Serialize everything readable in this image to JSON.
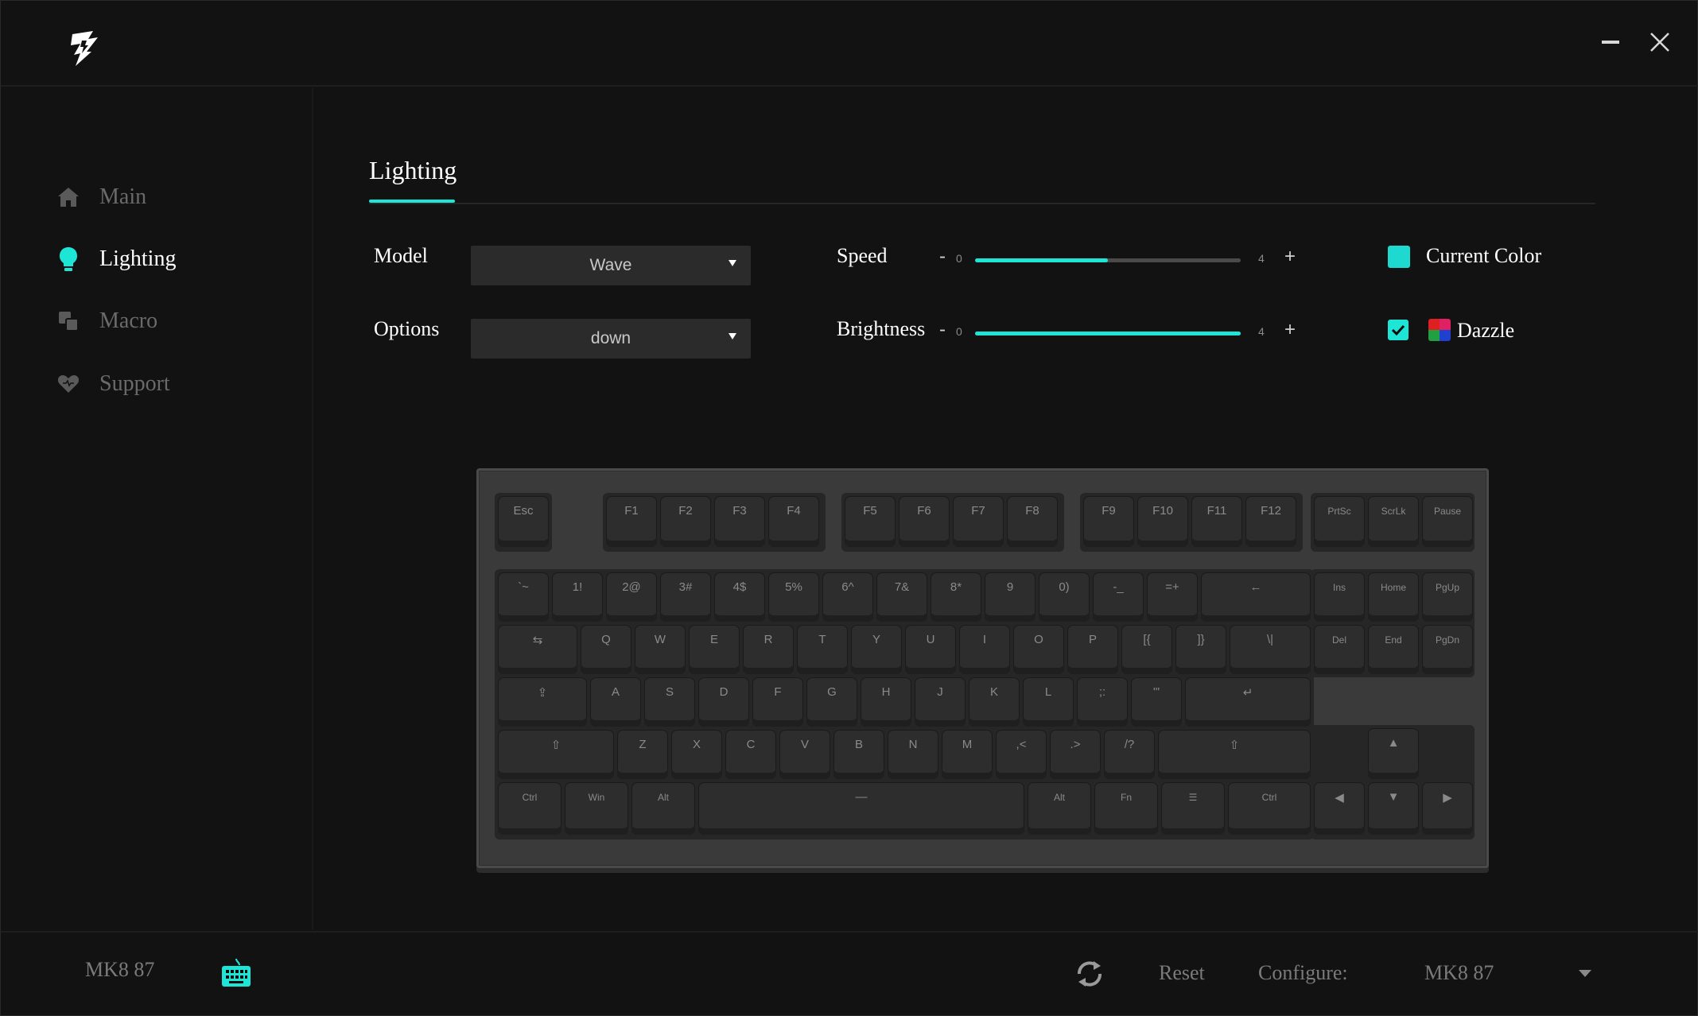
{
  "window": {
    "minimize_icon": "minimize-icon",
    "close_icon": "close-icon",
    "logo_icon": "brand-logo-icon"
  },
  "sidebar": {
    "items": [
      {
        "label": "Main",
        "icon": "home-icon",
        "active": false
      },
      {
        "label": "Lighting",
        "icon": "lightbulb-icon",
        "active": true
      },
      {
        "label": "Macro",
        "icon": "macro-icon",
        "active": false
      },
      {
        "label": "Support",
        "icon": "heart-icon",
        "active": false
      }
    ]
  },
  "content": {
    "tab": "Lighting",
    "model": {
      "label": "Model",
      "value": "Wave"
    },
    "options": {
      "label": "Options",
      "value": "down"
    },
    "speed": {
      "label": "Speed",
      "minus": "-",
      "plus": "+",
      "min": "0",
      "max": "4",
      "level": 2
    },
    "brightness": {
      "label": "Brightness",
      "minus": "-",
      "plus": "+",
      "min": "0",
      "max": "4",
      "level": 4
    },
    "current_color": {
      "label": "Current Color",
      "color": "#1ed9cf"
    },
    "dazzle": {
      "label": "Dazzle",
      "checked": true
    }
  },
  "keyboard": {
    "rows": {
      "fn": [
        "Esc",
        "F1",
        "F2",
        "F3",
        "F4",
        "F5",
        "F6",
        "F7",
        "F8",
        "F9",
        "F10",
        "F11",
        "F12",
        "PrtSc",
        "ScrLk",
        "Pause"
      ],
      "num": [
        "`~",
        "1!",
        "2@",
        "3#",
        "4$",
        "5%",
        "6^",
        "7&",
        "8*",
        "9",
        "0)",
        "-_",
        "=+",
        "←"
      ],
      "top": [
        "⇆",
        "Q",
        "W",
        "E",
        "R",
        "T",
        "Y",
        "U",
        "I",
        "O",
        "P",
        "[{",
        "]}",
        "\\|"
      ],
      "home": [
        "⇪",
        "A",
        "S",
        "D",
        "F",
        "G",
        "H",
        "J",
        "K",
        "L",
        ";:",
        "'\"",
        "↵"
      ],
      "shift": [
        "⇧",
        "Z",
        "X",
        "C",
        "V",
        "B",
        "N",
        "M",
        ",<",
        ".>",
        "/?",
        "⇧"
      ],
      "bottom": [
        "Ctrl",
        "Win",
        "Alt",
        "—",
        "Alt",
        "Fn",
        "☰",
        "Ctrl"
      ],
      "nav1": [
        "Ins",
        "Home",
        "PgUp"
      ],
      "nav2": [
        "Del",
        "End",
        "PgDn"
      ],
      "arrows": [
        "▲",
        "◀",
        "▼",
        "▶"
      ]
    }
  },
  "footer": {
    "device": "MK8 87",
    "device_icon": "keyboard-icon",
    "refresh_icon": "refresh-icon",
    "reset": "Reset",
    "configure_label": "Configure:",
    "configure_value": "MK8 87"
  }
}
